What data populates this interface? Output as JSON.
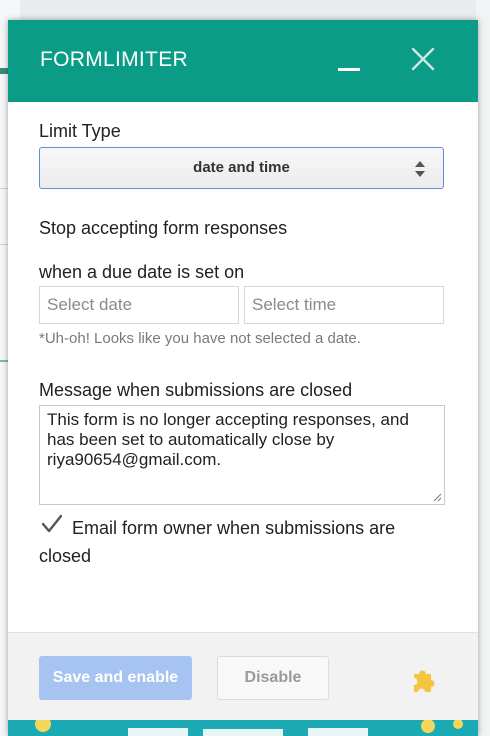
{
  "dialog": {
    "title": "FORMLIMITER",
    "minimize_icon": "minimize-icon",
    "close_icon": "close-icon"
  },
  "form": {
    "limit_type_label": "Limit Type",
    "limit_type_value": "date and time",
    "stop_label": "Stop accepting form responses",
    "due_label": "when a due date is set on",
    "date_placeholder": "Select date",
    "time_placeholder": "Select time",
    "error_text": "*Uh-oh! Looks like you have not selected a date.",
    "message_label": "Message when submissions are closed",
    "message_value": "This form is no longer accepting responses, and has been set to automatically close by riya90654@gmail.com.",
    "email_owner_label": "Email form owner when submissions are closed",
    "email_owner_checked": true
  },
  "footer": {
    "save_label": "Save and enable",
    "disable_label": "Disable",
    "addon_icon": "puzzle-icon"
  },
  "colors": {
    "header": "#0b9c88",
    "save_disabled": "#a7c3f1",
    "addon_icon": "#f5c542"
  }
}
